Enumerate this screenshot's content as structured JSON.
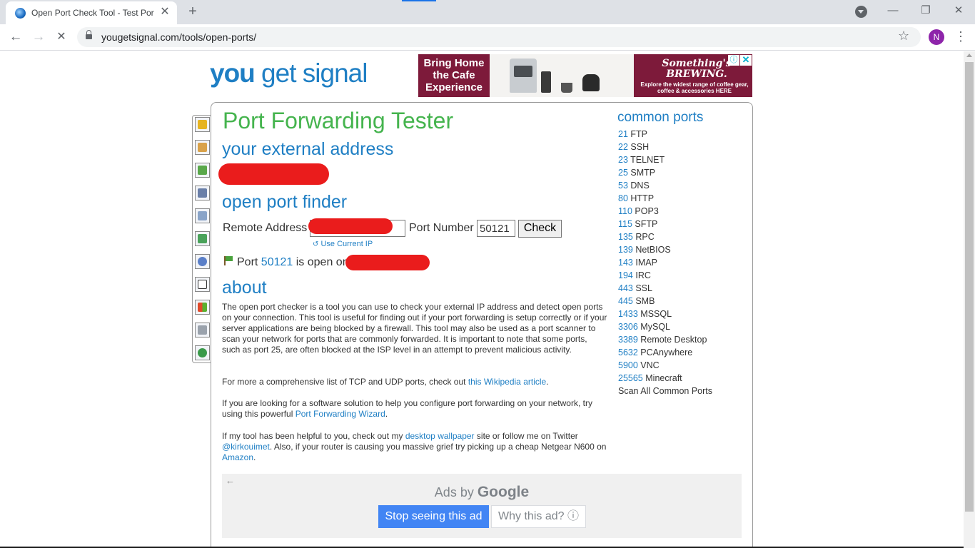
{
  "browser": {
    "tab_title": "Open Port Check Tool - Test Port",
    "tab_close": "✕",
    "new_tab": "+",
    "url": "yougetsignal.com/tools/open-ports/",
    "avatar_initial": "N",
    "back": "←",
    "forward": "→",
    "stop": "✕",
    "star": "☆",
    "menu": "⋮",
    "minimize": "—",
    "restore": "❐",
    "close": "✕"
  },
  "site": {
    "logo_you": "you",
    "logo_rest": " get signal"
  },
  "ad_banner": {
    "headline": "Bring Home the Cafe Experience",
    "brand": "Something's BREWING.",
    "brand_sub": "",
    "tagline": "Explore the widest range of coffee gear, coffee & accessories HERE",
    "choice_icon": "ⓘ",
    "close_icon": "✕"
  },
  "sidebar_icons": [
    "lock-icon",
    "map-icon",
    "graph-icon",
    "router-icon",
    "mail-icon",
    "network-icon",
    "help-icon",
    "google-icon",
    "windows-icon",
    "printer-icon",
    "globe-icon"
  ],
  "main": {
    "title": "Port Forwarding Tester",
    "external_heading": "your external address",
    "finder_heading": "open port finder",
    "remote_label": "Remote Address",
    "port_label": "Port Number",
    "port_value": "50121",
    "check_label": "Check",
    "use_current_ip": "Use Current IP",
    "result_prefix": "Port",
    "result_port": "50121",
    "result_suffix": "is open on",
    "about_heading": "about",
    "about_p1": "The open port checker is a tool you can use to check your external IP address and detect open ports on your connection. This tool is useful for finding out if your port forwarding is setup correctly or if your server applications are being blocked by a firewall. This tool may also be used as a port scanner to scan your network for ports that are commonly forwarded. It is important to note that some ports, such as port 25, are often blocked at the ISP level in an attempt to prevent malicious activity.",
    "about_p2_a": "For more a comprehensive list of TCP and UDP ports, check out",
    "about_p2_link": "this Wikipedia article",
    "about_p2_b": ".",
    "about_p3_a": "If you are looking for a software solution to help you configure port forwarding on your network, try using this powerful",
    "about_p3_link": "Port Forwarding Wizard",
    "about_p3_b": ".",
    "about_p4_a": "If my tool has been helpful to you, check out my",
    "about_p4_link1": "desktop wallpaper",
    "about_p4_b": "site or follow me on Twitter",
    "about_p4_link2": "@kirkouimet",
    "about_p4_c": ". Also, if your router is causing you massive grief try picking up a cheap Netgear N600 on",
    "about_p4_link3": "Amazon",
    "about_p4_d": "."
  },
  "common_ports": {
    "heading": "common ports",
    "items": [
      {
        "port": "21",
        "name": "FTP"
      },
      {
        "port": "22",
        "name": "SSH"
      },
      {
        "port": "23",
        "name": "TELNET"
      },
      {
        "port": "25",
        "name": "SMTP"
      },
      {
        "port": "53",
        "name": "DNS"
      },
      {
        "port": "80",
        "name": "HTTP"
      },
      {
        "port": "110",
        "name": "POP3"
      },
      {
        "port": "115",
        "name": "SFTP"
      },
      {
        "port": "135",
        "name": "RPC"
      },
      {
        "port": "139",
        "name": "NetBIOS"
      },
      {
        "port": "143",
        "name": "IMAP"
      },
      {
        "port": "194",
        "name": "IRC"
      },
      {
        "port": "443",
        "name": "SSL"
      },
      {
        "port": "445",
        "name": "SMB"
      },
      {
        "port": "1433",
        "name": "MSSQL"
      },
      {
        "port": "3306",
        "name": "MySQL"
      },
      {
        "port": "3389",
        "name": "Remote Desktop"
      },
      {
        "port": "5632",
        "name": "PCAnywhere"
      },
      {
        "port": "5900",
        "name": "VNC"
      },
      {
        "port": "25565",
        "name": "Minecraft"
      }
    ],
    "scan_all": "Scan All Common Ports"
  },
  "google_ad": {
    "back": "←",
    "ads_by": "Ads by",
    "google": "Google",
    "stop": "Stop seeing this ad",
    "why": "Why this ad? ⓘ"
  },
  "colors": {
    "title_green": "#45b44e",
    "heading_blue": "#1f7fc4",
    "redaction_red": "#ea1c1c",
    "ad_maroon": "#7d1a3a"
  }
}
